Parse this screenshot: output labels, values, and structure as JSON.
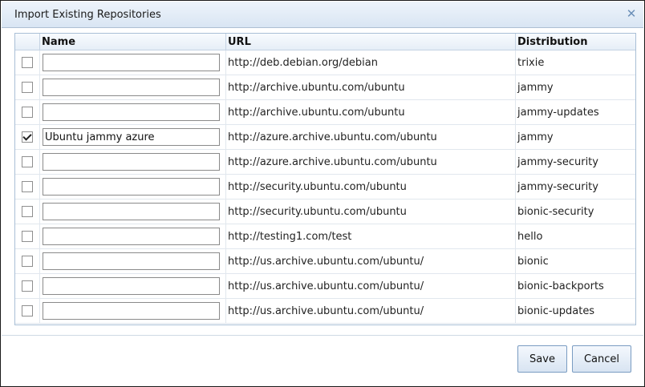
{
  "dialog": {
    "title": "Import Existing Repositories",
    "close_icon": "close-icon"
  },
  "table": {
    "headers": {
      "name": "Name",
      "url": "URL",
      "distribution": "Distribution"
    },
    "rows": [
      {
        "checked": false,
        "name": "",
        "url": "http://deb.debian.org/debian",
        "distribution": "trixie"
      },
      {
        "checked": false,
        "name": "",
        "url": "http://archive.ubuntu.com/ubuntu",
        "distribution": "jammy"
      },
      {
        "checked": false,
        "name": "",
        "url": "http://archive.ubuntu.com/ubuntu",
        "distribution": "jammy-updates"
      },
      {
        "checked": true,
        "name": "Ubuntu jammy azure",
        "url": "http://azure.archive.ubuntu.com/ubuntu",
        "distribution": "jammy"
      },
      {
        "checked": false,
        "name": "",
        "url": "http://azure.archive.ubuntu.com/ubuntu",
        "distribution": "jammy-security"
      },
      {
        "checked": false,
        "name": "",
        "url": "http://security.ubuntu.com/ubuntu",
        "distribution": "jammy-security"
      },
      {
        "checked": false,
        "name": "",
        "url": "http://security.ubuntu.com/ubuntu",
        "distribution": "bionic-security"
      },
      {
        "checked": false,
        "name": "",
        "url": "http://testing1.com/test",
        "distribution": "hello"
      },
      {
        "checked": false,
        "name": "",
        "url": "http://us.archive.ubuntu.com/ubuntu/",
        "distribution": "bionic"
      },
      {
        "checked": false,
        "name": "",
        "url": "http://us.archive.ubuntu.com/ubuntu/",
        "distribution": "bionic-backports"
      },
      {
        "checked": false,
        "name": "",
        "url": "http://us.archive.ubuntu.com/ubuntu/",
        "distribution": "bionic-updates"
      }
    ]
  },
  "buttons": {
    "save_label": "Save",
    "cancel_label": "Cancel"
  },
  "colors": {
    "titlebar": "#d9e5f3",
    "accent": "#7a9cc2",
    "border": "#a9bfd6"
  }
}
